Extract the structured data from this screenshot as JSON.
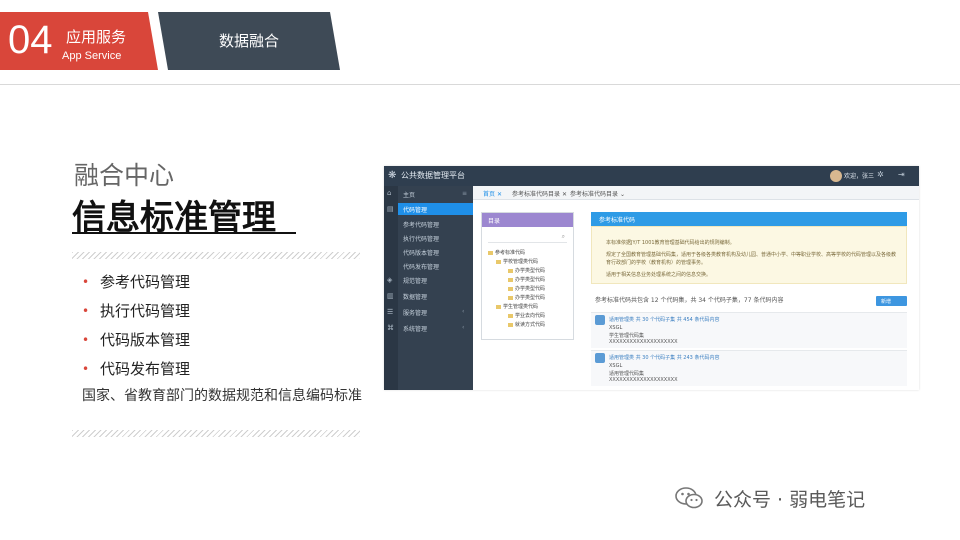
{
  "header": {
    "section_number": "04",
    "section_title_cn": "应用服务",
    "section_title_en": "App Service",
    "page_title": "数据融合"
  },
  "content": {
    "subtitle": "融合中心",
    "title": "信息标准管理",
    "bullets": [
      "参考代码管理",
      "执行代码管理",
      "代码版本管理",
      "代码发布管理"
    ],
    "description": "国家、省教育部门的数据规范和信息编码标准"
  },
  "screenshot": {
    "app_title": "公共数据管理平台",
    "user_label": "欢迎，张三",
    "sidebar": {
      "home": "主页",
      "items": [
        {
          "label": "代码管理",
          "active": true
        },
        {
          "label": "参考代码管理"
        },
        {
          "label": "执行代码管理"
        },
        {
          "label": "代码版本管理"
        },
        {
          "label": "代码发布管理"
        },
        {
          "label": "规范管理"
        },
        {
          "label": "数据管理"
        },
        {
          "label": "服务管理"
        },
        {
          "label": "系统管理"
        }
      ]
    },
    "tabs": [
      {
        "label": "首页",
        "active": true
      },
      {
        "label": "参考标准代码目录"
      },
      {
        "label": "参考标准代码目录"
      }
    ],
    "tree": {
      "header": "目录",
      "nodes": [
        "参考标准代码",
        "学校管理类代码",
        "办学类型代码",
        "办学类型代码",
        "办学类型代码",
        "办学类型代码",
        "学生管理类代码",
        "学业去向代码",
        "就读方式代码"
      ]
    },
    "info": {
      "header": "参考标准代码",
      "lines": [
        "本标准依据JY/T 1001教育管理基础代码给出的规则编制。",
        "规定了全国教育管理基础代码集，适用于各级各类教育机构及幼儿园、普通中小学、中等职业学校、高等学校的代码管理以及各级教",
        "育行政部门的学校（教育机构）的管理事务。",
        "适用于相关信息业务处理系统之间的信息交换。"
      ]
    },
    "summary": "参考标准代码共包含 12 个代码集，共 34 个代码子集，77 条代码内容",
    "button": "新增",
    "items": [
      {
        "head": "适用管理类 共 30 个代码子集 共 454 条代码内容",
        "line1": "XSGL",
        "line2": "学生管理代码集",
        "line3": "XXXXXXXXXXXXXXXXXXXX"
      },
      {
        "head": "适用管理类 共 30 个代码子集 共 243 条代码内容",
        "line1": "XSGL",
        "line2": "适用管理代码集",
        "line3": "XXXXXXXXXXXXXXXXXXXX"
      }
    ]
  },
  "watermark": "公众号 · 弱电笔记"
}
